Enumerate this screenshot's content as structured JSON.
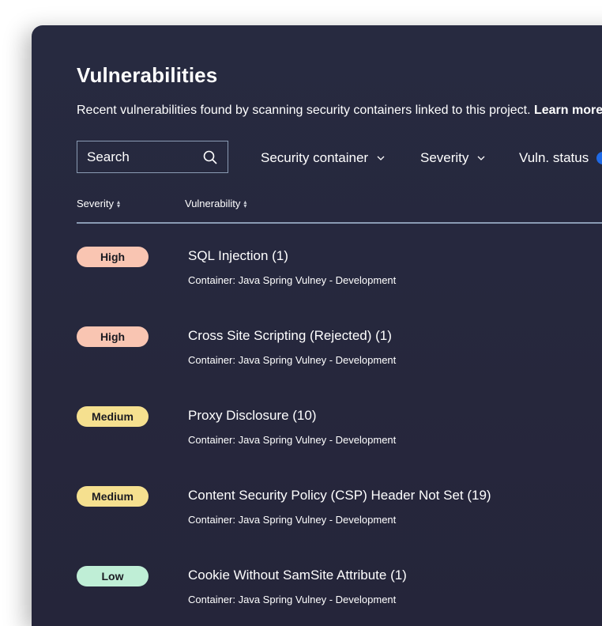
{
  "page": {
    "title": "Vulnerabilities",
    "description": "Recent vulnerabilities found by scanning security containers linked to this project.",
    "learn_more_label": "Learn more"
  },
  "search": {
    "placeholder": "Search",
    "value": "",
    "icon": "search-icon"
  },
  "filters": [
    {
      "label": "Security container",
      "icon": "chevron-down-icon"
    },
    {
      "label": "Severity",
      "icon": "chevron-down-icon"
    },
    {
      "label": "Vuln. status",
      "indicator_color": "#1f6ae6"
    }
  ],
  "table": {
    "columns": [
      {
        "label": "Severity",
        "sortable": true
      },
      {
        "label": "Vulnerability",
        "sortable": true
      }
    ],
    "rows": [
      {
        "severity": "High",
        "name": "SQL Injection (1)",
        "container": "Container: Java Spring Vulney - Development"
      },
      {
        "severity": "High",
        "name": "Cross Site Scripting (Rejected) (1)",
        "container": "Container: Java Spring Vulney - Development"
      },
      {
        "severity": "Medium",
        "name": "Proxy Disclosure (10)",
        "container": "Container: Java Spring Vulney - Development"
      },
      {
        "severity": "Medium",
        "name": "Content Security Policy (CSP) Header Not Set (19)",
        "container": "Container: Java Spring Vulney - Development"
      },
      {
        "severity": "Low",
        "name": "Cookie Without SamSite Attribute (1)",
        "container": "Container: Java Spring Vulney - Development"
      }
    ]
  },
  "colors": {
    "panel_bg": "#272a40",
    "high": "#f9c5b2",
    "medium": "#f5e08f",
    "low": "#bfeed6",
    "border": "#8a9bb3",
    "accent_blue": "#1f6ae6"
  }
}
